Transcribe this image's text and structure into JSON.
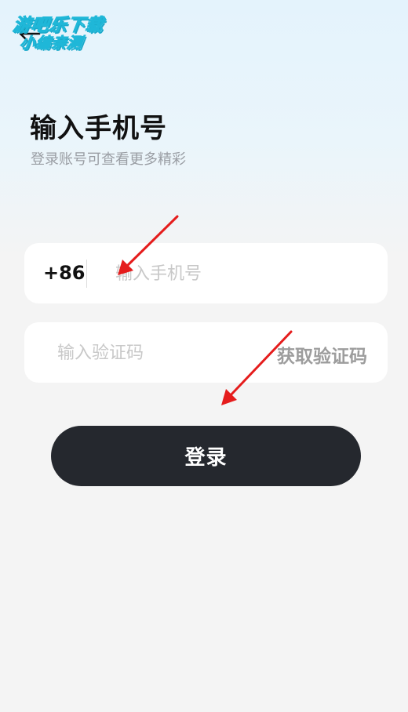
{
  "watermark": {
    "line1": "游吧乐下载",
    "line2": "小编亲测"
  },
  "header": {
    "back_icon": "arrow-left-icon"
  },
  "page": {
    "title": "输入手机号",
    "subtitle": "登录账号可查看更多精彩"
  },
  "phone_field": {
    "country_code": "+86",
    "value": "",
    "placeholder": "输入手机号"
  },
  "code_field": {
    "value": "",
    "placeholder": "输入验证码",
    "get_code_label": "获取验证码"
  },
  "login_button": {
    "label": "登录"
  },
  "colors": {
    "primary_button": "#25282e",
    "annotation_arrow": "#e51c1c",
    "watermark_accent": "#1fb7d8"
  }
}
